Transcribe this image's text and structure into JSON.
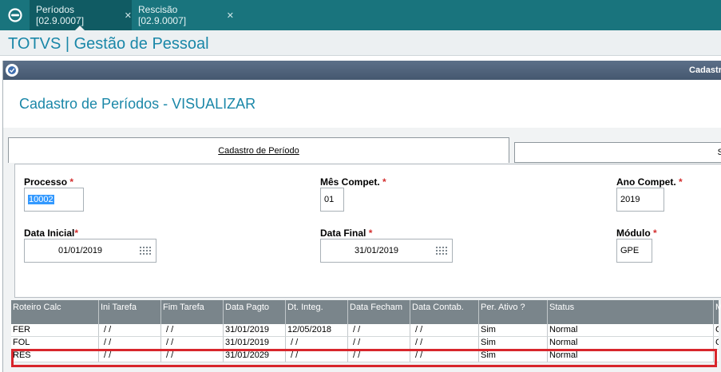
{
  "tabs": [
    {
      "label": "Períodos [02.9.0007]",
      "active": true
    },
    {
      "label": "Rescisão [02.9.0007]",
      "active": false
    }
  ],
  "app": {
    "title": "TOTVS | Gestão de Pessoal"
  },
  "window": {
    "title_fragment": "Cadastr"
  },
  "form": {
    "title": "Cadastro de Períodos - VISUALIZAR"
  },
  "folders": [
    {
      "label": "Cadastro de Período"
    },
    {
      "label": "S"
    }
  ],
  "fields": {
    "processo": {
      "label": "Processo",
      "value": "10002"
    },
    "mes_compet": {
      "label": "Mês Compet.",
      "value": "01"
    },
    "ano_compet": {
      "label": "Ano Compet.",
      "value": "2019"
    },
    "data_inicial": {
      "label": "Data Inicial",
      "value": "01/01/2019"
    },
    "data_final": {
      "label": "Data Final",
      "value": "31/01/2019"
    },
    "modulo": {
      "label": "Módulo",
      "value": "GPE"
    }
  },
  "required_mark": "*",
  "close_glyph": "✕",
  "grid": {
    "columns": [
      "Roteiro Calc",
      "Ini Tarefa",
      "Fim Tarefa",
      "Data Pagto",
      "Dt. Integ.",
      "Data Fecham",
      "Data Contab.",
      "Per. Ativo ?",
      "Status",
      "M"
    ],
    "rows": [
      [
        "FER",
        " / /",
        " / /",
        "31/01/2019",
        "12/05/2018",
        " / /",
        " / /",
        "Sim",
        "Normal",
        "G"
      ],
      [
        "FOL",
        " / /",
        " / /",
        "31/01/2019",
        "  / /",
        " / /",
        " / /",
        "Sim",
        "Normal",
        "G"
      ],
      [
        "RES",
        " / /",
        " / /",
        "31/01/2029",
        "  / /",
        " / /",
        " / /",
        "Sim",
        "Normal",
        ""
      ]
    ]
  },
  "colors": {
    "topbar": "#19747d",
    "active_tab": "#105b63",
    "title_blue": "#1a87a8",
    "required": "#d32f2f",
    "highlight": "#d8262c"
  }
}
